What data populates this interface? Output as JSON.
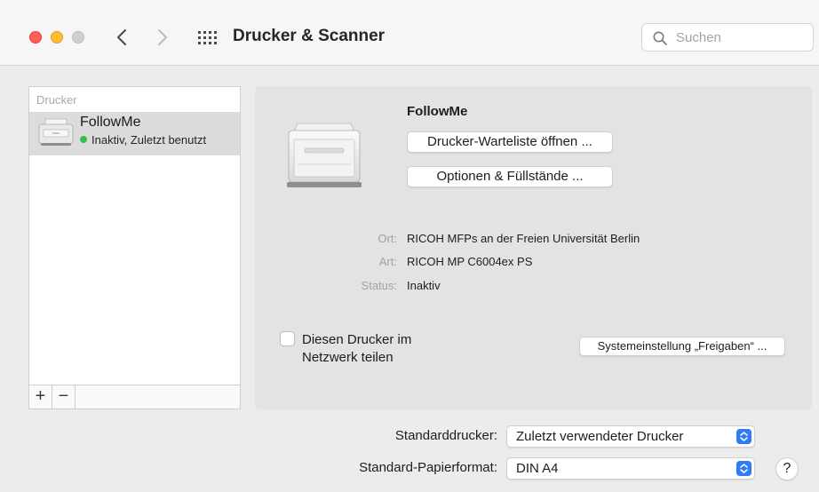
{
  "window": {
    "title": "Drucker & Scanner",
    "search": {
      "placeholder": "Suchen",
      "value": ""
    }
  },
  "sidebar": {
    "header": "Drucker",
    "printers": [
      {
        "name": "FollowMe",
        "status": "Inaktiv, Zuletzt benutzt",
        "status_color": "#2fc14b",
        "selected": true
      }
    ],
    "add_label": "+",
    "remove_label": "−"
  },
  "detail": {
    "name": "FollowMe",
    "queue_button": "Drucker-Warteliste öffnen ...",
    "options_button": "Optionen & Füllstände ...",
    "info": [
      {
        "label": "Ort:",
        "value": "RICOH MFPs an der Freien Universität Berlin"
      },
      {
        "label": "Art:",
        "value": "RICOH MP C6004ex PS"
      },
      {
        "label": "Status:",
        "value": "Inaktiv"
      }
    ],
    "share_checkbox": {
      "label": "Diesen Drucker im Netzwerk teilen",
      "checked": false
    },
    "sharing_button": "Systemeinstellung „Freigaben“ ..."
  },
  "bottom": {
    "default_printer_label": "Standarddrucker:",
    "default_printer_value": "Zuletzt verwendeter Drucker",
    "paper_label": "Standard-Papierformat:",
    "paper_value": "DIN A4",
    "help_label": "?"
  },
  "colors": {
    "accent": "#2f7cf6",
    "close": "#ff5f57",
    "minimize": "#febc2e",
    "maximize_inactive": "#d0d0d0",
    "status_active": "#2fc14b"
  }
}
